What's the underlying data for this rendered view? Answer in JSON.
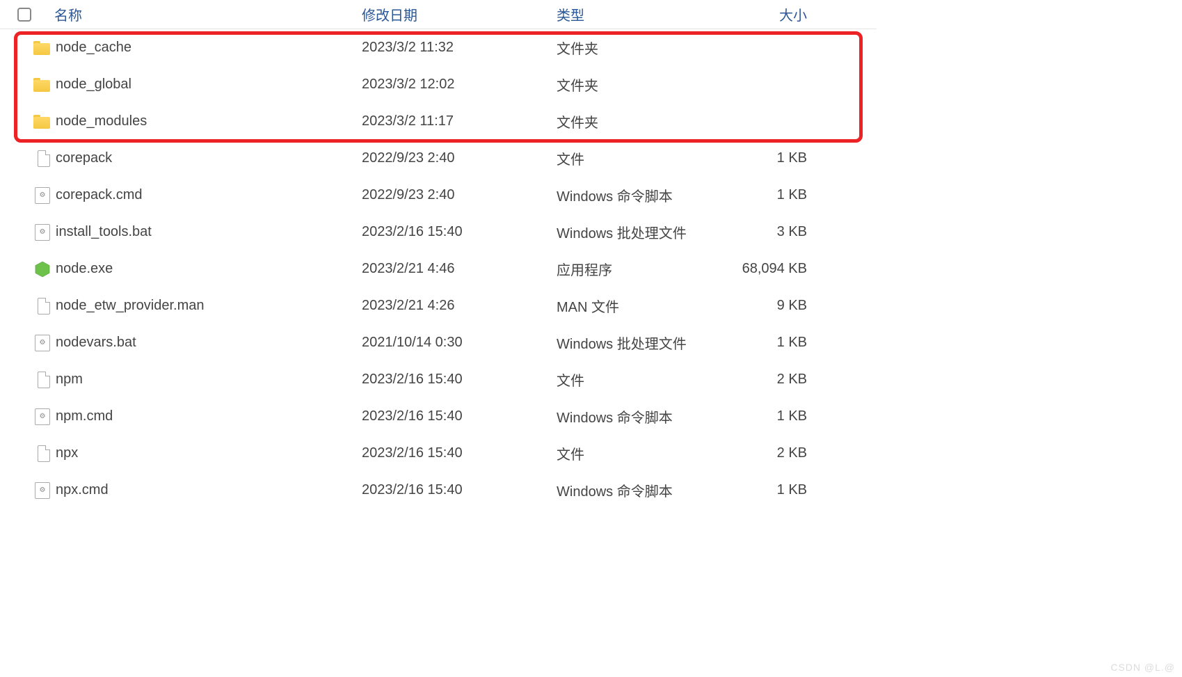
{
  "header": {
    "name": "名称",
    "date": "修改日期",
    "type": "类型",
    "size": "大小"
  },
  "rows": [
    {
      "icon": "folder",
      "name": "node_cache",
      "date": "2023/3/2 11:32",
      "type": "文件夹",
      "size": ""
    },
    {
      "icon": "folder",
      "name": "node_global",
      "date": "2023/3/2 12:02",
      "type": "文件夹",
      "size": ""
    },
    {
      "icon": "folder",
      "name": "node_modules",
      "date": "2023/3/2 11:17",
      "type": "文件夹",
      "size": ""
    },
    {
      "icon": "file",
      "name": "corepack",
      "date": "2022/9/23 2:40",
      "type": "文件",
      "size": "1 KB"
    },
    {
      "icon": "gear",
      "name": "corepack.cmd",
      "date": "2022/9/23 2:40",
      "type": "Windows 命令脚本",
      "size": "1 KB"
    },
    {
      "icon": "gear",
      "name": "install_tools.bat",
      "date": "2023/2/16 15:40",
      "type": "Windows 批处理文件",
      "size": "3 KB"
    },
    {
      "icon": "node",
      "name": "node.exe",
      "date": "2023/2/21 4:46",
      "type": "应用程序",
      "size": "68,094 KB"
    },
    {
      "icon": "file",
      "name": "node_etw_provider.man",
      "date": "2023/2/21 4:26",
      "type": "MAN 文件",
      "size": "9 KB"
    },
    {
      "icon": "gear",
      "name": "nodevars.bat",
      "date": "2021/10/14 0:30",
      "type": "Windows 批处理文件",
      "size": "1 KB"
    },
    {
      "icon": "file",
      "name": "npm",
      "date": "2023/2/16 15:40",
      "type": "文件",
      "size": "2 KB"
    },
    {
      "icon": "gear",
      "name": "npm.cmd",
      "date": "2023/2/16 15:40",
      "type": "Windows 命令脚本",
      "size": "1 KB"
    },
    {
      "icon": "file",
      "name": "npx",
      "date": "2023/2/16 15:40",
      "type": "文件",
      "size": "2 KB"
    },
    {
      "icon": "gear",
      "name": "npx.cmd",
      "date": "2023/2/16 15:40",
      "type": "Windows 命令脚本",
      "size": "1 KB"
    }
  ],
  "watermark": "CSDN @L.@"
}
